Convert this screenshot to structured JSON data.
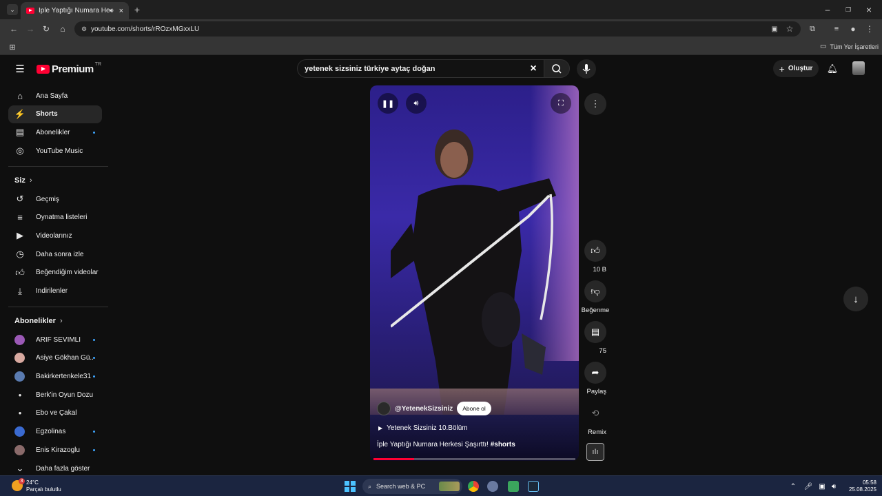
{
  "browser": {
    "tab_title": "İple Yaptığı Numara Herkesi",
    "url": "youtube.com/shorts/rROzxMGxxLU",
    "bookmarks_all": "Tüm Yer İşaretleri"
  },
  "youtube": {
    "logo_text": "Premium",
    "logo_region": "TR",
    "search_value": "yetenek sizsiniz türkiye aytaç doğan",
    "create_label": "Oluştur",
    "sidebar": {
      "main": [
        {
          "label": "Ana Sayfa",
          "icon": "home-icon"
        },
        {
          "label": "Shorts",
          "icon": "shorts-icon"
        },
        {
          "label": "Abonelikler",
          "icon": "subscriptions-icon"
        },
        {
          "label": "YouTube Music",
          "icon": "music-icon"
        }
      ],
      "you_heading": "Siz",
      "you": [
        {
          "label": "Geçmiş",
          "icon": "history-icon"
        },
        {
          "label": "Oynatma listeleri",
          "icon": "playlists-icon"
        },
        {
          "label": "Videolarınız",
          "icon": "your-videos-icon"
        },
        {
          "label": "Daha sonra izle",
          "icon": "watch-later-icon"
        },
        {
          "label": "Beğendiğim videolar",
          "icon": "liked-icon"
        },
        {
          "label": "İndirilenler",
          "icon": "download-icon"
        }
      ],
      "subs_heading": "Abonelikler",
      "subs": [
        {
          "label": "ARİF SEVİMLİ",
          "color": "#9b59b6"
        },
        {
          "label": "Asiye Gökhan Gü...",
          "color": "#d8a9a0"
        },
        {
          "label": "Bakirkertenkele31",
          "color": "#5a7bb0"
        },
        {
          "label": "Berk'in Oyun Dozu",
          "color": "#7a6a5a"
        },
        {
          "label": "Ebo ve Çakal",
          "color": "#6a6a6a"
        },
        {
          "label": "Egzolinas",
          "color": "#3a6ad0"
        },
        {
          "label": "Enis Kirazoglu",
          "color": "#8a6a6a"
        }
      ],
      "show_more": "Daha fazla göster"
    },
    "short": {
      "channel": "@YetenekSizsiniz",
      "subscribe": "Abone ol",
      "playlist": "Yetenek Sizsiniz 10.Bölüm",
      "title": "İple Yaptığı Numara Herkesi Şaşırttı!",
      "hashtag": "#shorts",
      "progress": 0.2
    },
    "actions": {
      "likes": "10 B",
      "dislike": "Beğenme",
      "comments": "75",
      "share": "Paylaş",
      "remix": "Remix"
    }
  },
  "taskbar": {
    "temp": "24°C",
    "weather": "Parçalı bulutlu",
    "search": "Search web & PC",
    "time": "05:58",
    "date": "25.08.2025",
    "badge": "3"
  }
}
